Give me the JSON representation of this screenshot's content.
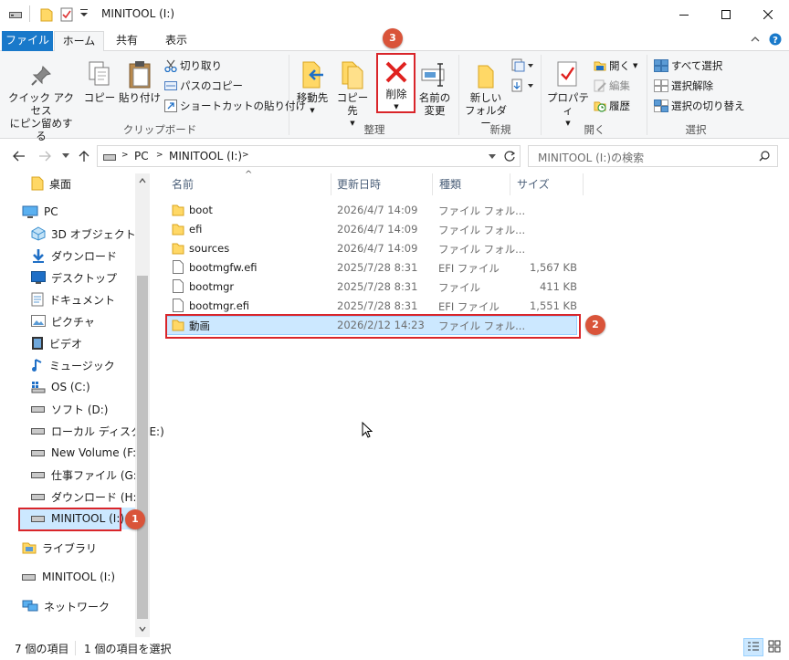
{
  "window": {
    "title": "MINITOOL (I:)"
  },
  "tabs": [
    {
      "label": "ファイル"
    },
    {
      "label": "ホーム"
    },
    {
      "label": "共有"
    },
    {
      "label": "表示"
    }
  ],
  "ribbon": {
    "clipboard": {
      "pin_label": "クイック アクセス\nにピン留めする",
      "copy_label": "コピー",
      "paste_label": "貼り付け",
      "cut_label": "切り取り",
      "copy_path_label": "パスのコピー",
      "paste_shortcut_label": "ショートカットの貼り付け",
      "group_label": "クリップボード"
    },
    "organize": {
      "move_label": "移動先",
      "copy_to_label": "コピー先",
      "delete_label": "削除",
      "rename_label": "名前の\n変更",
      "group_label": "整理"
    },
    "new": {
      "new_folder_label": "新しい\nフォルダー",
      "group_label": "新規"
    },
    "open": {
      "properties_label": "プロパティ",
      "open_label": "開く",
      "edit_label": "編集",
      "history_label": "履歴",
      "group_label": "開く"
    },
    "select": {
      "select_all_label": "すべて選択",
      "select_none_label": "選択解除",
      "invert_label": "選択の切り替え",
      "group_label": "選択"
    }
  },
  "address": {
    "crumbs": [
      "PC",
      "MINITOOL (I:)"
    ],
    "search_placeholder": "MINITOOL (I:)の検索"
  },
  "nav": {
    "items": [
      {
        "label": "桌面",
        "icon": "folder-icon"
      },
      {
        "label": "PC",
        "icon": "pc-icon"
      },
      {
        "label": "3D オブジェクト",
        "icon": "3d-objects-icon"
      },
      {
        "label": "ダウンロード",
        "icon": "download-icon"
      },
      {
        "label": "デスクトップ",
        "icon": "desktop-icon"
      },
      {
        "label": "ドキュメント",
        "icon": "documents-icon"
      },
      {
        "label": "ピクチャ",
        "icon": "pictures-icon"
      },
      {
        "label": "ビデオ",
        "icon": "videos-icon"
      },
      {
        "label": "ミュージック",
        "icon": "music-icon"
      },
      {
        "label": "OS (C:)",
        "icon": "os-drive-icon"
      },
      {
        "label": "ソフト (D:)",
        "icon": "drive-icon"
      },
      {
        "label": "ローカル ディスク (E:)",
        "icon": "drive-icon"
      },
      {
        "label": "New Volume (F:)",
        "icon": "drive-icon"
      },
      {
        "label": "仕事ファイル (G:)",
        "icon": "drive-icon"
      },
      {
        "label": "ダウンロード (H:)",
        "icon": "drive-icon"
      },
      {
        "label": "MINITOOL (I:)",
        "icon": "drive-icon"
      },
      {
        "label": "ライブラリ",
        "icon": "library-icon"
      },
      {
        "label": "MINITOOL (I:)",
        "icon": "drive-icon"
      },
      {
        "label": "ネットワーク",
        "icon": "network-icon"
      }
    ]
  },
  "columns": {
    "name": "名前",
    "date": "更新日時",
    "type": "種類",
    "size": "サイズ"
  },
  "files": [
    {
      "name": "boot",
      "date": "2026/4/7 14:09",
      "type": "ファイル フォル...",
      "size": "",
      "kind": "folder"
    },
    {
      "name": "efi",
      "date": "2026/4/7 14:09",
      "type": "ファイル フォル...",
      "size": "",
      "kind": "folder"
    },
    {
      "name": "sources",
      "date": "2026/4/7 14:09",
      "type": "ファイル フォル...",
      "size": "",
      "kind": "folder"
    },
    {
      "name": "bootmgfw.efi",
      "date": "2025/7/28 8:31",
      "type": "EFI ファイル",
      "size": "1,567 KB",
      "kind": "file"
    },
    {
      "name": "bootmgr",
      "date": "2025/7/28 8:31",
      "type": "ファイル",
      "size": "411 KB",
      "kind": "file"
    },
    {
      "name": "bootmgr.efi",
      "date": "2025/7/28 8:31",
      "type": "EFI ファイル",
      "size": "1,551 KB",
      "kind": "file"
    },
    {
      "name": "動画",
      "date": "2026/2/12 14:23",
      "type": "ファイル フォル...",
      "size": "",
      "kind": "folder"
    }
  ],
  "status": {
    "item_count": "7 個の項目",
    "selected_count": "1 個の項目を選択"
  },
  "callouts": [
    "1",
    "2",
    "3"
  ],
  "colors": {
    "accent": "#1979ca",
    "callout": "#d9543a",
    "highlight_box": "#d9252a",
    "selection": "#cce8ff"
  }
}
